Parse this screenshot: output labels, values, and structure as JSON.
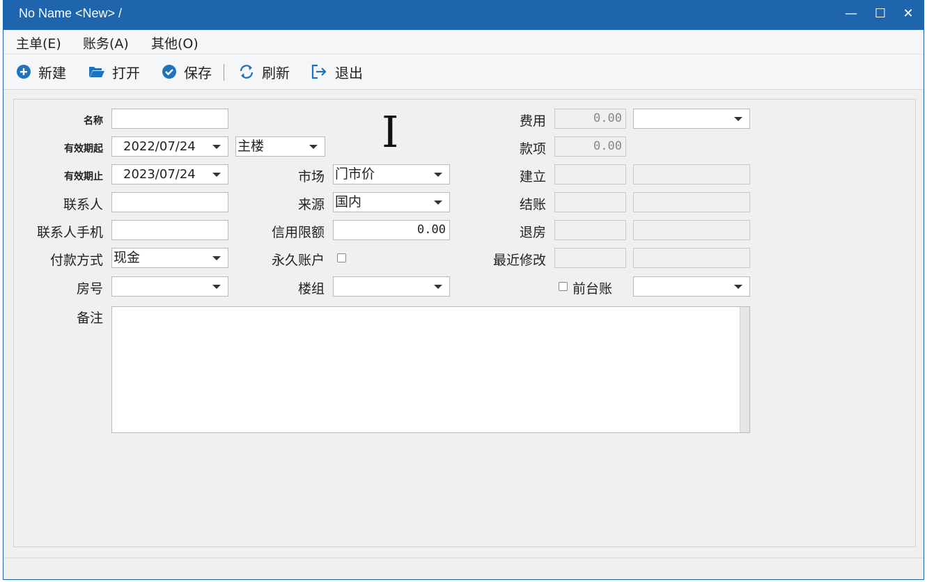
{
  "window": {
    "title": "No Name <New> /",
    "minimize": "—",
    "maximize": "☐",
    "close": "✕"
  },
  "menu": [
    "主单(E)",
    "账务(A)",
    "其他(O)"
  ],
  "toolbar": {
    "new": "新建",
    "open": "打开",
    "save": "保存",
    "refresh": "刷新",
    "exit": "退出",
    "accent": "#1e73be"
  },
  "form": {
    "name_label": "名称",
    "name_value": "",
    "valid_from_label": "有效期起",
    "valid_from": "2022/07/24",
    "building_value": "主楼",
    "valid_to_label": "有效期止",
    "valid_to": "2023/07/24",
    "market_label": "市场",
    "market_value": "门市价",
    "contact_label": "联系人",
    "contact_value": "",
    "source_label": "来源",
    "source_value": "国内",
    "contact_phone_label": "联系人手机",
    "contact_phone_value": "",
    "credit_label": "信用限额",
    "credit_value": "0.00",
    "payment_label": "付款方式",
    "payment_value": "现金",
    "permanent_label": "永久账户",
    "room_label": "房号",
    "room_value": "",
    "building_group_label": "楼组",
    "building_group_value": "",
    "fee_label": "费用",
    "fee_value": "0.00",
    "fee_select": "",
    "amount_label": "款项",
    "amount_value": "0.00",
    "created_label": "建立",
    "checkout_label": "结账",
    "checkout_room_label": "退房",
    "modified_label": "最近修改",
    "front_desk_label": "前台账",
    "front_desk_select": "",
    "remark_label": "备注",
    "remark_value": ""
  },
  "cursor_glyph": "I"
}
